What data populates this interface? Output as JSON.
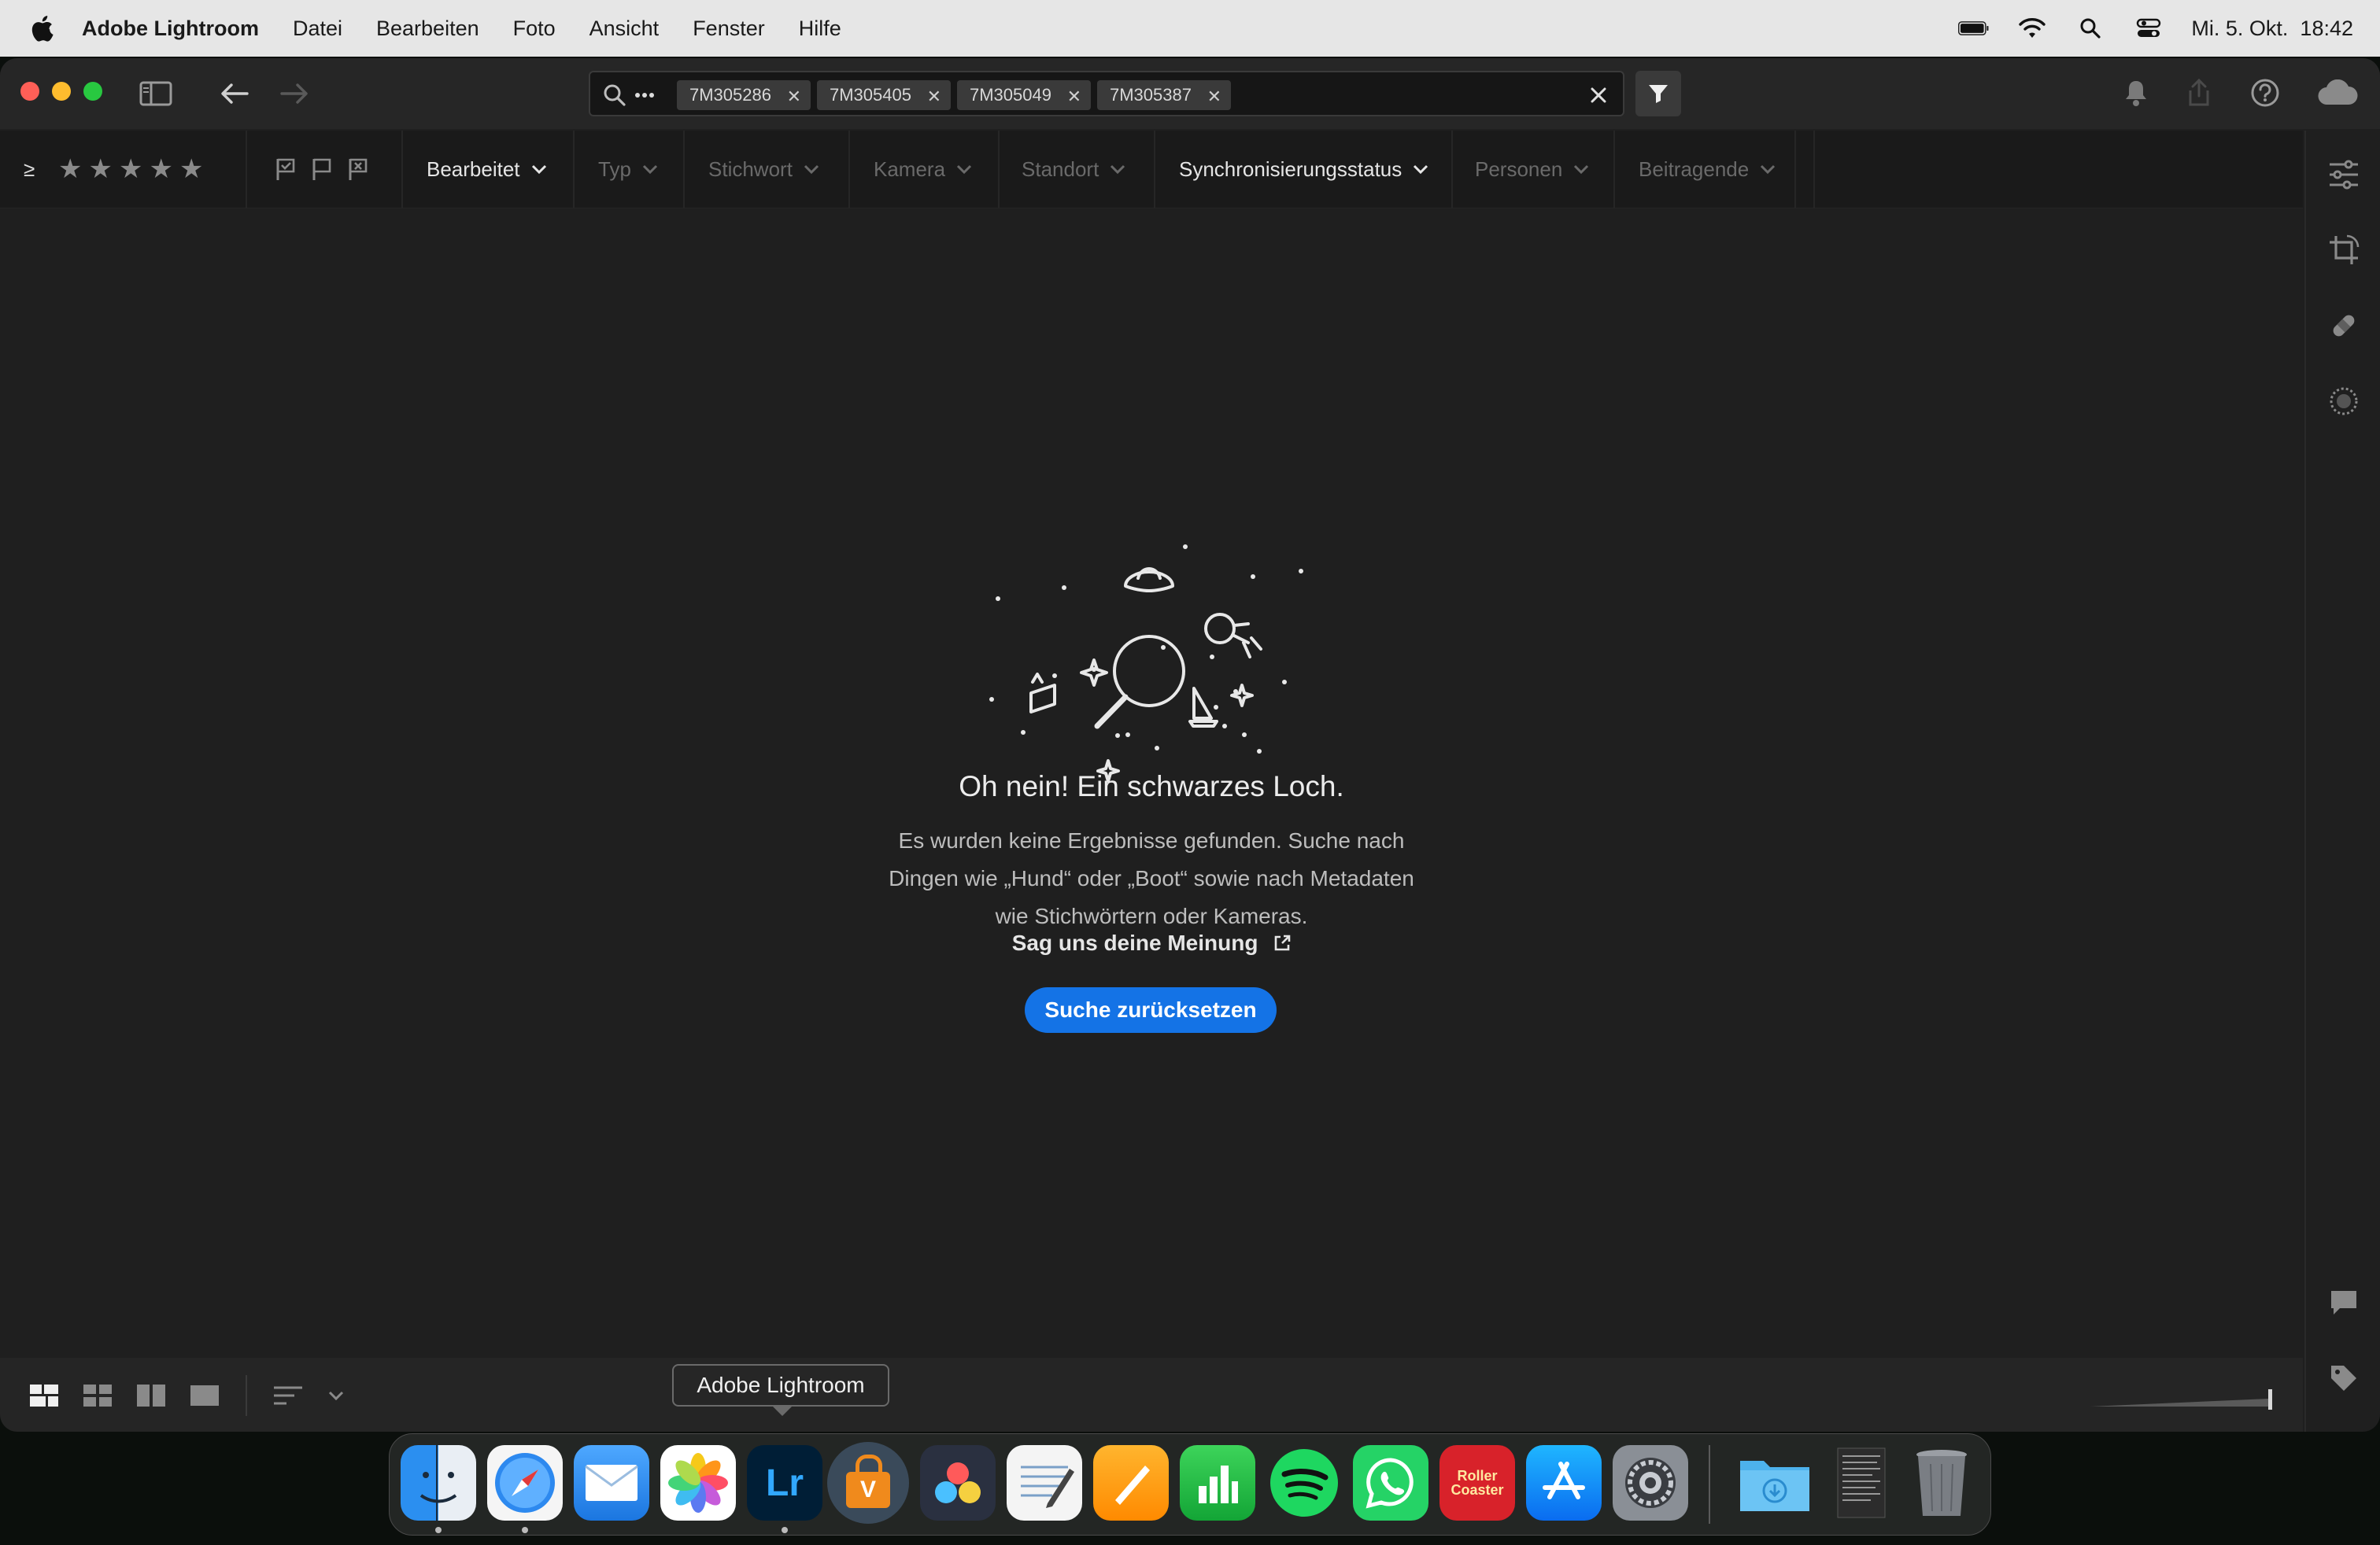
{
  "menubar": {
    "app_name": "Adobe Lightroom",
    "items": [
      "Datei",
      "Bearbeiten",
      "Foto",
      "Ansicht",
      "Fenster",
      "Hilfe"
    ],
    "datetime": "Mi. 5. Okt.  18:42"
  },
  "search": {
    "chips": [
      "7M305286",
      "7M305405",
      "7M305049",
      "7M305387"
    ]
  },
  "filterbar": {
    "range_symbol": "≥",
    "stars": 5,
    "filters": [
      {
        "label": "Bearbeitet",
        "active": true
      },
      {
        "label": "Typ",
        "active": false
      },
      {
        "label": "Stichwort",
        "active": false
      },
      {
        "label": "Kamera",
        "active": false
      },
      {
        "label": "Standort",
        "active": false
      },
      {
        "label": "Synchronisierungsstatus",
        "active": true
      },
      {
        "label": "Personen",
        "active": false
      },
      {
        "label": "Beitragende",
        "active": false
      }
    ]
  },
  "empty_state": {
    "title": "Oh nein! Ein schwarzes Loch.",
    "body": "Es wurden keine Ergebnisse gefunden. Suche nach Dingen wie „Hund“ oder „Boot“ sowie nach Metadaten wie Stichwörtern oder Kameras.",
    "feedback_link": "Sag uns deine Meinung",
    "reset_button": "Suche zurücksetzen"
  },
  "dock": {
    "tooltip": "Adobe Lightroom",
    "apps": [
      {
        "name": "Finder",
        "icon": "finder-icon",
        "running": true
      },
      {
        "name": "Safari",
        "icon": "safari-icon",
        "running": true
      },
      {
        "name": "Mail",
        "icon": "mail-icon",
        "running": false
      },
      {
        "name": "Fotos",
        "icon": "photos-icon",
        "running": false
      },
      {
        "name": "Adobe Lightroom",
        "icon": "lightroom-icon",
        "label": "Lr",
        "running": true
      },
      {
        "name": "VPN",
        "icon": "vpn-lock-icon",
        "label": "V",
        "running": false
      },
      {
        "name": "DaVinci Resolve",
        "icon": "davinci-icon",
        "running": false
      },
      {
        "name": "TextEdit",
        "icon": "textedit-icon",
        "running": false
      },
      {
        "name": "Pages",
        "icon": "pages-icon",
        "running": false
      },
      {
        "name": "Numbers",
        "icon": "numbers-icon",
        "running": false
      },
      {
        "name": "Spotify",
        "icon": "spotify-icon",
        "running": false
      },
      {
        "name": "WhatsApp",
        "icon": "whatsapp-icon",
        "running": false
      },
      {
        "name": "RollerCoaster Tycoon",
        "icon": "rollercoaster-icon",
        "label": "Roller Coaster",
        "running": false
      },
      {
        "name": "App Store",
        "icon": "appstore-icon",
        "running": false
      },
      {
        "name": "Systemeinstellungen",
        "icon": "settings-icon",
        "running": false
      },
      {
        "name": "Downloads",
        "icon": "downloads-folder-icon",
        "running": false
      },
      {
        "name": "Dokument",
        "icon": "document-stack-icon",
        "running": false
      },
      {
        "name": "Papierkorb",
        "icon": "trash-icon",
        "running": false
      }
    ]
  },
  "colors": {
    "accent": "#1473e6",
    "panel": "#1f1f1f",
    "menubar": "#e6e6e6"
  }
}
